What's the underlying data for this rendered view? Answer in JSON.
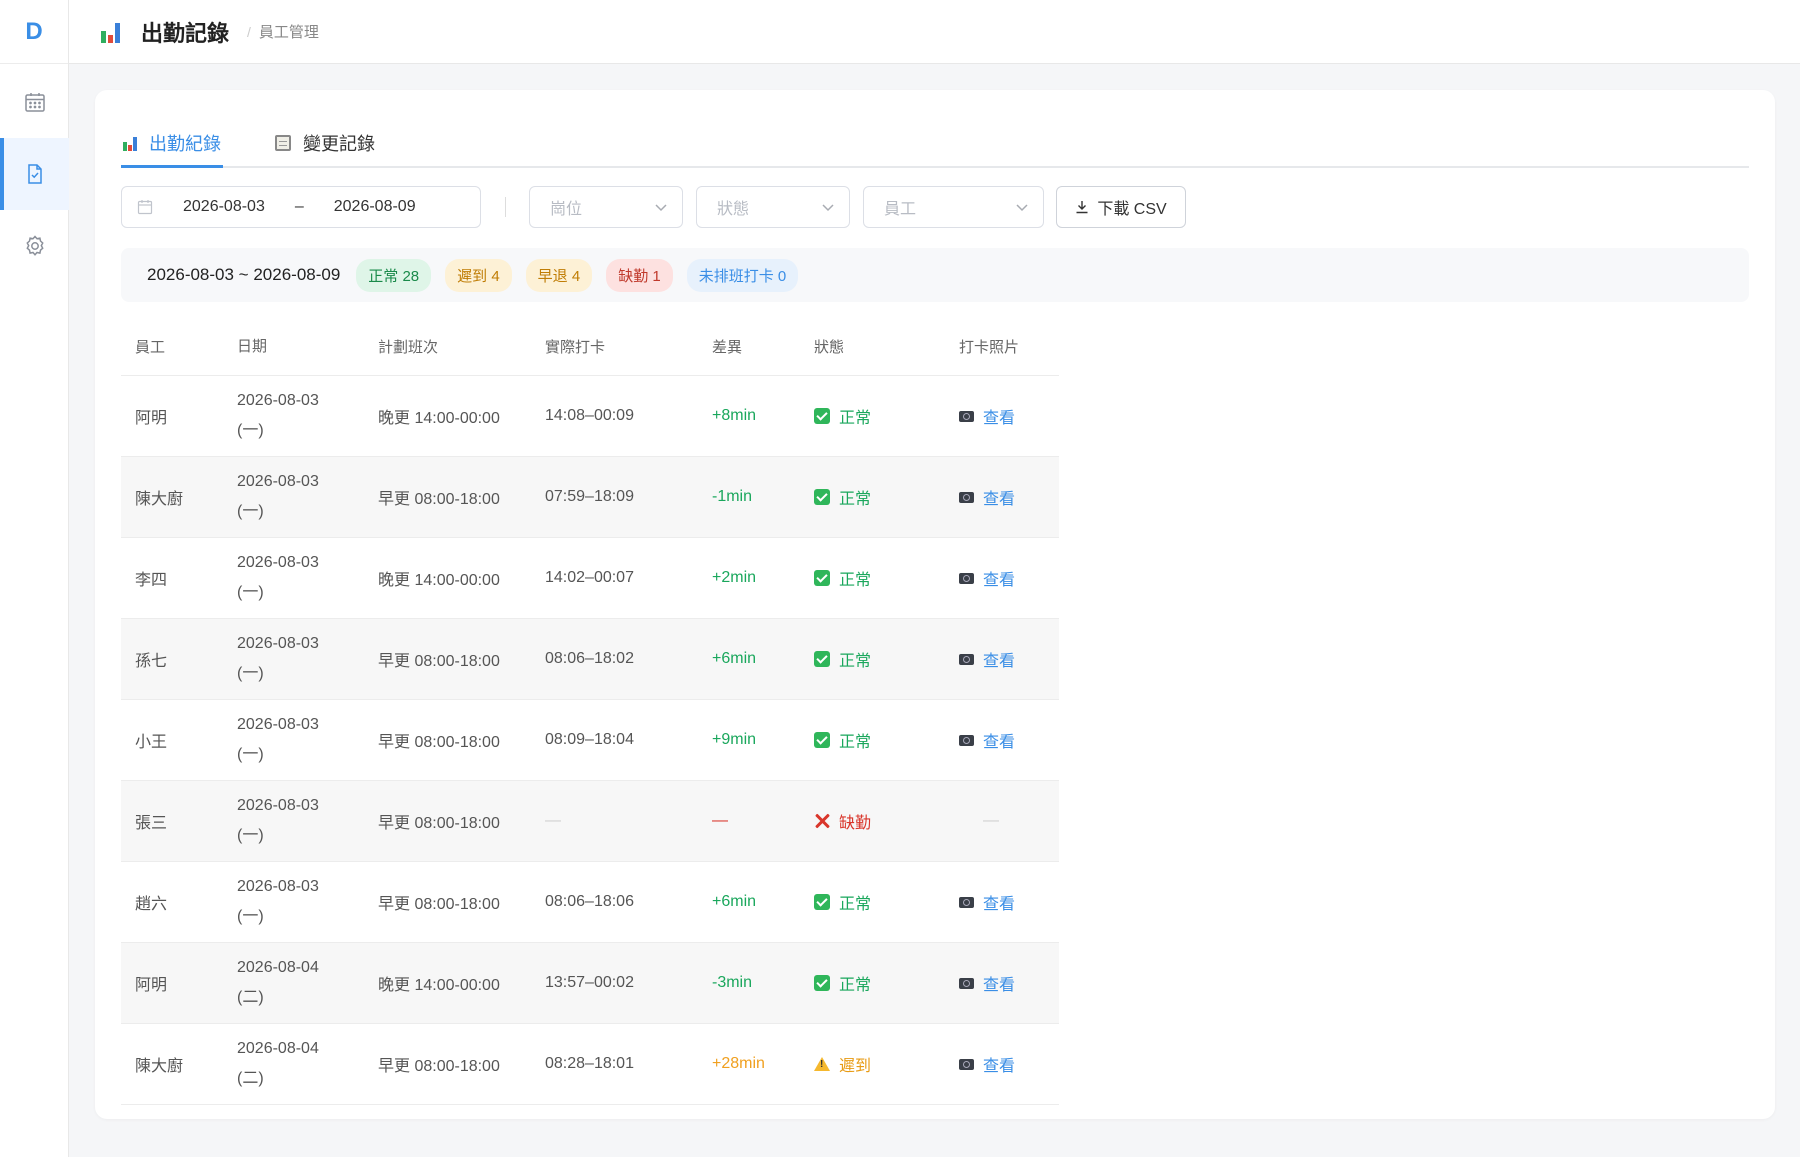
{
  "app": {
    "logo": "D"
  },
  "header": {
    "title": "出勤記錄",
    "crumb": "員工管理"
  },
  "tabs": [
    {
      "label": "出勤紀錄",
      "active": true
    },
    {
      "label": "變更記錄",
      "active": false
    }
  ],
  "filters": {
    "date_start": "2026-08-03",
    "date_end": "2026-08-09",
    "position_placeholder": "崗位",
    "status_placeholder": "狀態",
    "employee_placeholder": "員工",
    "download_label": "下載 CSV"
  },
  "summary": {
    "range": "2026-08-03 ~ 2026-08-09",
    "normal": "正常 28",
    "late": "遲到 4",
    "early": "早退 4",
    "absent": "缺勤 1",
    "unscheduled": "未排班打卡 0"
  },
  "table": {
    "headers": [
      "員工",
      "日期",
      "計劃班次",
      "實際打卡",
      "差異",
      "狀態",
      "打卡照片"
    ],
    "rows": [
      {
        "name": "阿明",
        "date": "2026-08-03",
        "weekday": "(一)",
        "shift": "晚更 14:00-00:00",
        "actual": "14:08–00:09",
        "diff": "+8min",
        "status": "正常",
        "photo": "查看"
      },
      {
        "name": "陳大廚",
        "date": "2026-08-03",
        "weekday": "(一)",
        "shift": "早更 08:00-18:00",
        "actual": "07:59–18:09",
        "diff": "-1min",
        "status": "正常",
        "photo": "查看"
      },
      {
        "name": "李四",
        "date": "2026-08-03",
        "weekday": "(一)",
        "shift": "晚更 14:00-00:00",
        "actual": "14:02–00:07",
        "diff": "+2min",
        "status": "正常",
        "photo": "查看"
      },
      {
        "name": "孫七",
        "date": "2026-08-03",
        "weekday": "(一)",
        "shift": "早更 08:00-18:00",
        "actual": "08:06–18:02",
        "diff": "+6min",
        "status": "正常",
        "photo": "查看"
      },
      {
        "name": "小王",
        "date": "2026-08-03",
        "weekday": "(一)",
        "shift": "早更 08:00-18:00",
        "actual": "08:09–18:04",
        "diff": "+9min",
        "status": "正常",
        "photo": "查看"
      },
      {
        "name": "張三",
        "date": "2026-08-03",
        "weekday": "(一)",
        "shift": "早更 08:00-18:00",
        "actual": "—",
        "diff": "—",
        "status": "缺勤",
        "photo": "—"
      },
      {
        "name": "趙六",
        "date": "2026-08-03",
        "weekday": "(一)",
        "shift": "早更 08:00-18:00",
        "actual": "08:06–18:06",
        "diff": "+6min",
        "status": "正常",
        "photo": "查看"
      },
      {
        "name": "阿明",
        "date": "2026-08-04",
        "weekday": "(二)",
        "shift": "晚更 14:00-00:00",
        "actual": "13:57–00:02",
        "diff": "-3min",
        "status": "正常",
        "photo": "查看"
      },
      {
        "name": "陳大廚",
        "date": "2026-08-04",
        "weekday": "(二)",
        "shift": "早更 08:00-18:00",
        "actual": "08:28–18:01",
        "diff": "+28min",
        "status": "遲到",
        "photo": "查看"
      }
    ]
  },
  "colors": {
    "accent": "#3a8ee6",
    "success": "#1aa75c",
    "warning": "#f0a020",
    "danger": "#d9362b"
  }
}
